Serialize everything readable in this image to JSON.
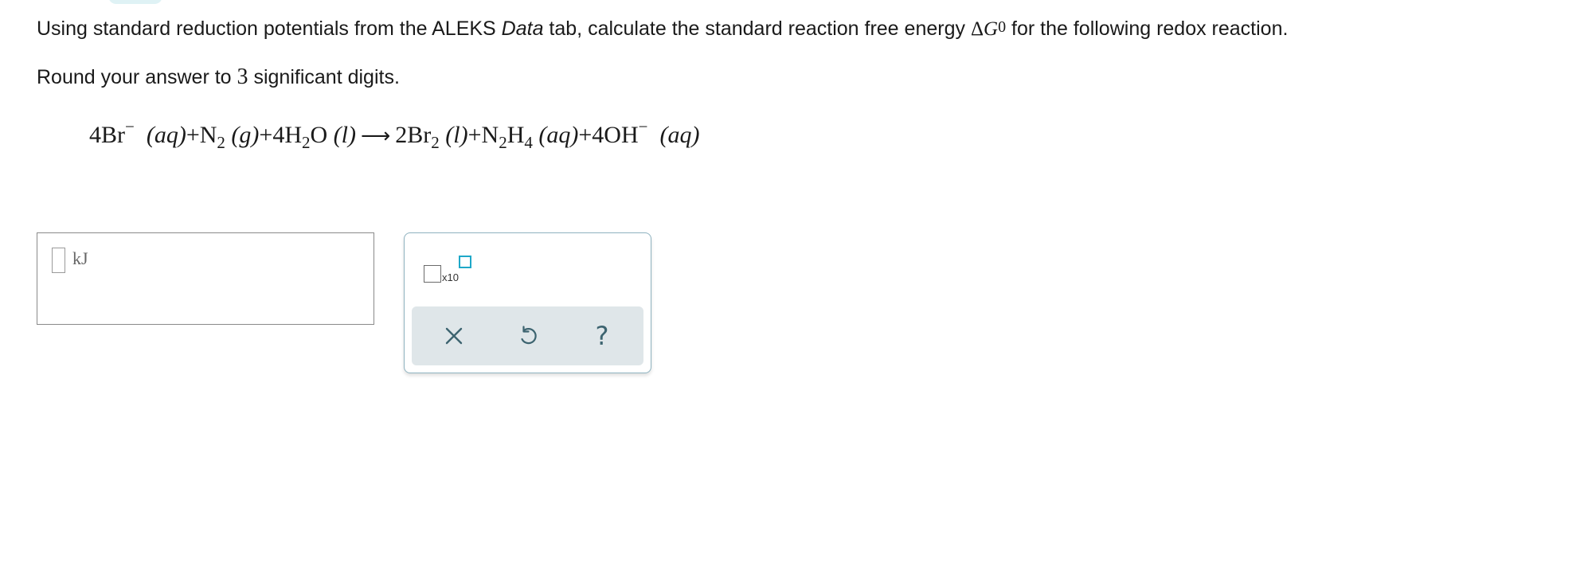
{
  "question": {
    "intro": "Using standard reduction potentials from the ALEKS ",
    "data_word": "Data",
    "middle": " tab, calculate the standard reaction free energy ",
    "delta": "Δ",
    "G": "G",
    "superscript": "0",
    "outro": " for the following redox reaction."
  },
  "rounding": {
    "before": "Round your answer to ",
    "digits": "3",
    "after": " significant digits."
  },
  "equation": {
    "term1_coef": "4Br",
    "term1_charge": "−",
    "term1_state": "(aq)",
    "plus1": "+",
    "term2_sym": "N",
    "term2_sub": "2",
    "term2_state": "(g)",
    "plus2": "+",
    "term3_sym": "4H",
    "term3_sub": "2",
    "term3_tail": "O",
    "term3_state": "(l)",
    "arrow": "⟶",
    "term4_sym": "2Br",
    "term4_sub": "2",
    "term4_state": "(l)",
    "plus3": "+",
    "term5_n": "N",
    "term5_sub1": "2",
    "term5_h": "H",
    "term5_sub2": "4",
    "term5_state": "(aq)",
    "plus4": "+",
    "term6_sym": "4OH",
    "term6_charge": "−",
    "term6_state": "(aq)"
  },
  "answer": {
    "unit": "kJ"
  },
  "tools": {
    "x10_label": "x10",
    "help_label": "?"
  },
  "colors": {
    "accent": "#1ea8c8",
    "panel_border": "#8fb3c0",
    "action_bar": "#dfe6e9",
    "icon": "#3d6470"
  }
}
